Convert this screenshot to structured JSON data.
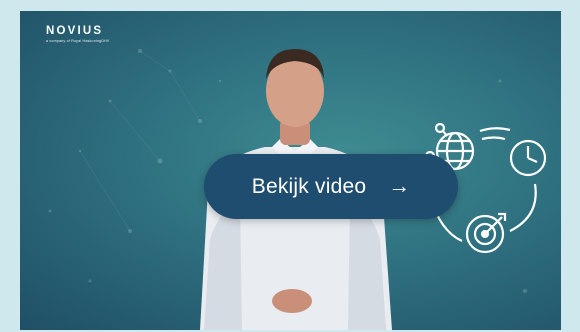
{
  "brand": {
    "name": "NOVIUS",
    "tagline": "a company of Royal HaskoningDHV"
  },
  "video": {
    "play_label": "Bekijk video",
    "arrow_icon": "arrow-right-icon"
  },
  "colors": {
    "page_bg": "#cfe8ee",
    "button_bg": "#1f4d6f",
    "video_bg": "#2f7180",
    "icon_stroke": "#ffffff"
  },
  "icons": [
    "globe-network-icon",
    "clock-icon",
    "target-arrow-icon"
  ]
}
